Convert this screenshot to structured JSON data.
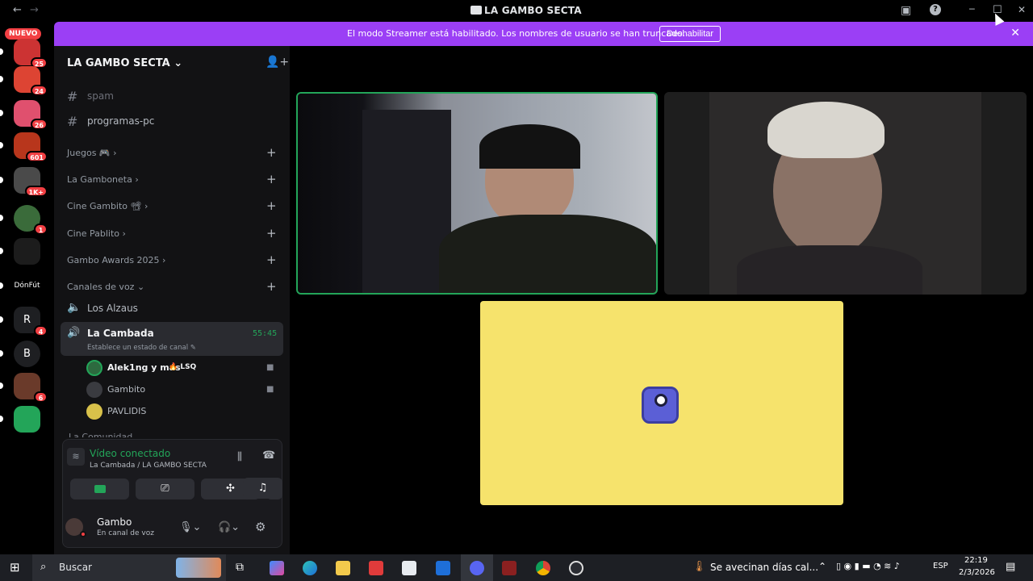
{
  "window": {
    "title": "LA GAMBO SECTA",
    "back": "←",
    "forward": "→"
  },
  "titlebar_icons": {
    "inbox": "▣",
    "help": "?",
    "minimize": "─",
    "maximize": "☐",
    "close": "✕"
  },
  "banner": {
    "text": "El modo Streamer está habilitado. Los nombres de usuario se han truncado.",
    "button": "Deshabilitar",
    "close": "✕"
  },
  "rail": {
    "nuevo": "NUEVO",
    "servers": [
      {
        "badge": "25",
        "color": "#c33"
      },
      {
        "badge": "24",
        "color": "#d43"
      },
      {
        "badge": "26",
        "color": "#e0506e"
      },
      {
        "badge": "601",
        "color": "#b8361c"
      },
      {
        "badge": "1K+",
        "color": "#4a4a4a"
      },
      {
        "badge": "1",
        "color": "#3a6b3a"
      },
      {
        "badge": "",
        "color": "#1c1c1c"
      },
      {
        "badge": "",
        "text": "DónFút",
        "color": "#000"
      },
      {
        "badge": "4",
        "text": "R",
        "color": "#1e1f22"
      },
      {
        "badge": "",
        "text": "B",
        "color": "#1e1f22"
      },
      {
        "badge": "6",
        "color": "#6a3a2a"
      },
      {
        "badge": "",
        "color": "#23a559"
      }
    ]
  },
  "sidebar": {
    "server_name": "LA GAMBO SECTA ⌄",
    "channels": [
      {
        "name": "spam"
      },
      {
        "name": "programas-pc"
      }
    ],
    "categories": [
      {
        "label": "Juegos 🎮  ›"
      },
      {
        "label": "La Gamboneta  ›"
      },
      {
        "label": "Cine Gambito 📽  ›"
      },
      {
        "label": "Cine Pablito  ›"
      },
      {
        "label": "Gambo Awards 2025  ›"
      },
      {
        "label": "Canales de voz  ⌄"
      }
    ],
    "voice_channels": [
      {
        "name": "Los Alzaus"
      },
      {
        "name": "La Cambada",
        "timer": "55:45",
        "status": "Establece un estado de canal ✎"
      }
    ],
    "voice_users": [
      {
        "name": "Alek1ng y más",
        "tag": "🔥 LSQ"
      },
      {
        "name": "Gambito"
      },
      {
        "name": "PAVLIDIS"
      }
    ],
    "partial_channel": "La Comunidad"
  },
  "voice_panel": {
    "status": "Vídeo conectado",
    "location": "La Cambada / LA GAMBO SECTA",
    "buttons": [
      "camera",
      "screen-share",
      "activities",
      "soundboard"
    ]
  },
  "user": {
    "name": "Gambo",
    "status": "En canal de voz"
  },
  "taskbar": {
    "search": "Buscar",
    "weather": "Se avecinan días cal...",
    "lang": "ESP",
    "time": "22:19",
    "date": "2/3/2026"
  },
  "colors": {
    "accent": "#9b3ff5",
    "green": "#23a559",
    "red": "#f23f43",
    "stage_yellow": "#f6e36c"
  }
}
